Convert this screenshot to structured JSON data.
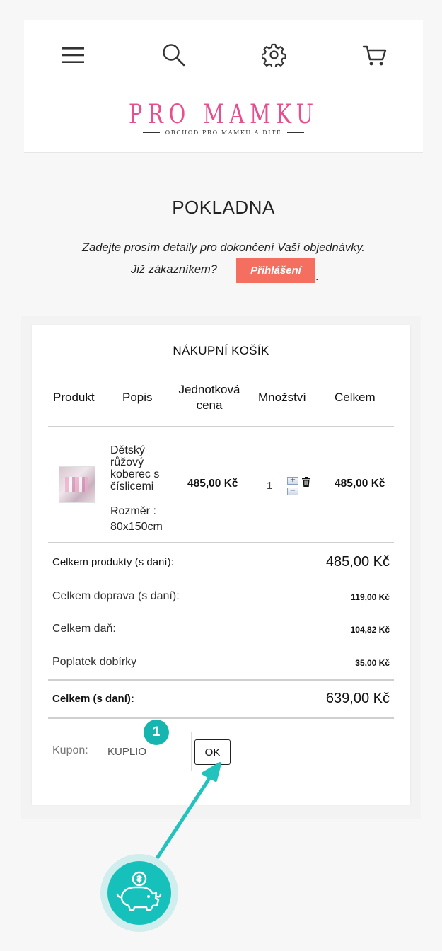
{
  "header": {
    "icons": [
      "menu-icon",
      "search-icon",
      "gear-icon",
      "cart-icon"
    ],
    "logo_title": "PRO MAMKU",
    "logo_subtitle": "OBCHOD PRO MAMKU A DÍTĚ"
  },
  "page": {
    "title": "POKLADNA",
    "intro": "Zadejte prosím detaily pro dokončení Vaší objednávky.",
    "customer_prompt": "Již zákazníkem?",
    "login_label": "Přihlášení",
    "dot": "."
  },
  "cart": {
    "title": "NÁKUPNÍ KOŠÍK",
    "columns": {
      "product": "Produkt",
      "description": "Popis",
      "unit_price": "Jednotková cena",
      "quantity": "Množství",
      "total": "Celkem"
    },
    "items": [
      {
        "name": "Dětský růžový koberec s číslicemi",
        "size": "Rozměr : 80x150cm",
        "unit_price": "485,00 Kč",
        "quantity": "1",
        "total": "485,00 Kč"
      }
    ],
    "summary": {
      "products_label": "Celkem produkty (s daní):",
      "products_value": "485,00 Kč",
      "shipping_label": "Celkem doprava (s daní):",
      "shipping_value": "119,00 Kč",
      "tax_label": "Celkem daň:",
      "tax_value": "104,82 Kč",
      "cod_label": "Poplatek dobírky",
      "cod_value": "35,00 Kč",
      "grand_label": "Celkem (s daní):",
      "grand_value": "639,00 Kč"
    },
    "coupon": {
      "label": "Kupon:",
      "value": "KUPLIO",
      "button": "OK"
    }
  },
  "annotation": {
    "step": "1",
    "accent": "#16b5b0",
    "icon": "piggy-bank-icon"
  }
}
